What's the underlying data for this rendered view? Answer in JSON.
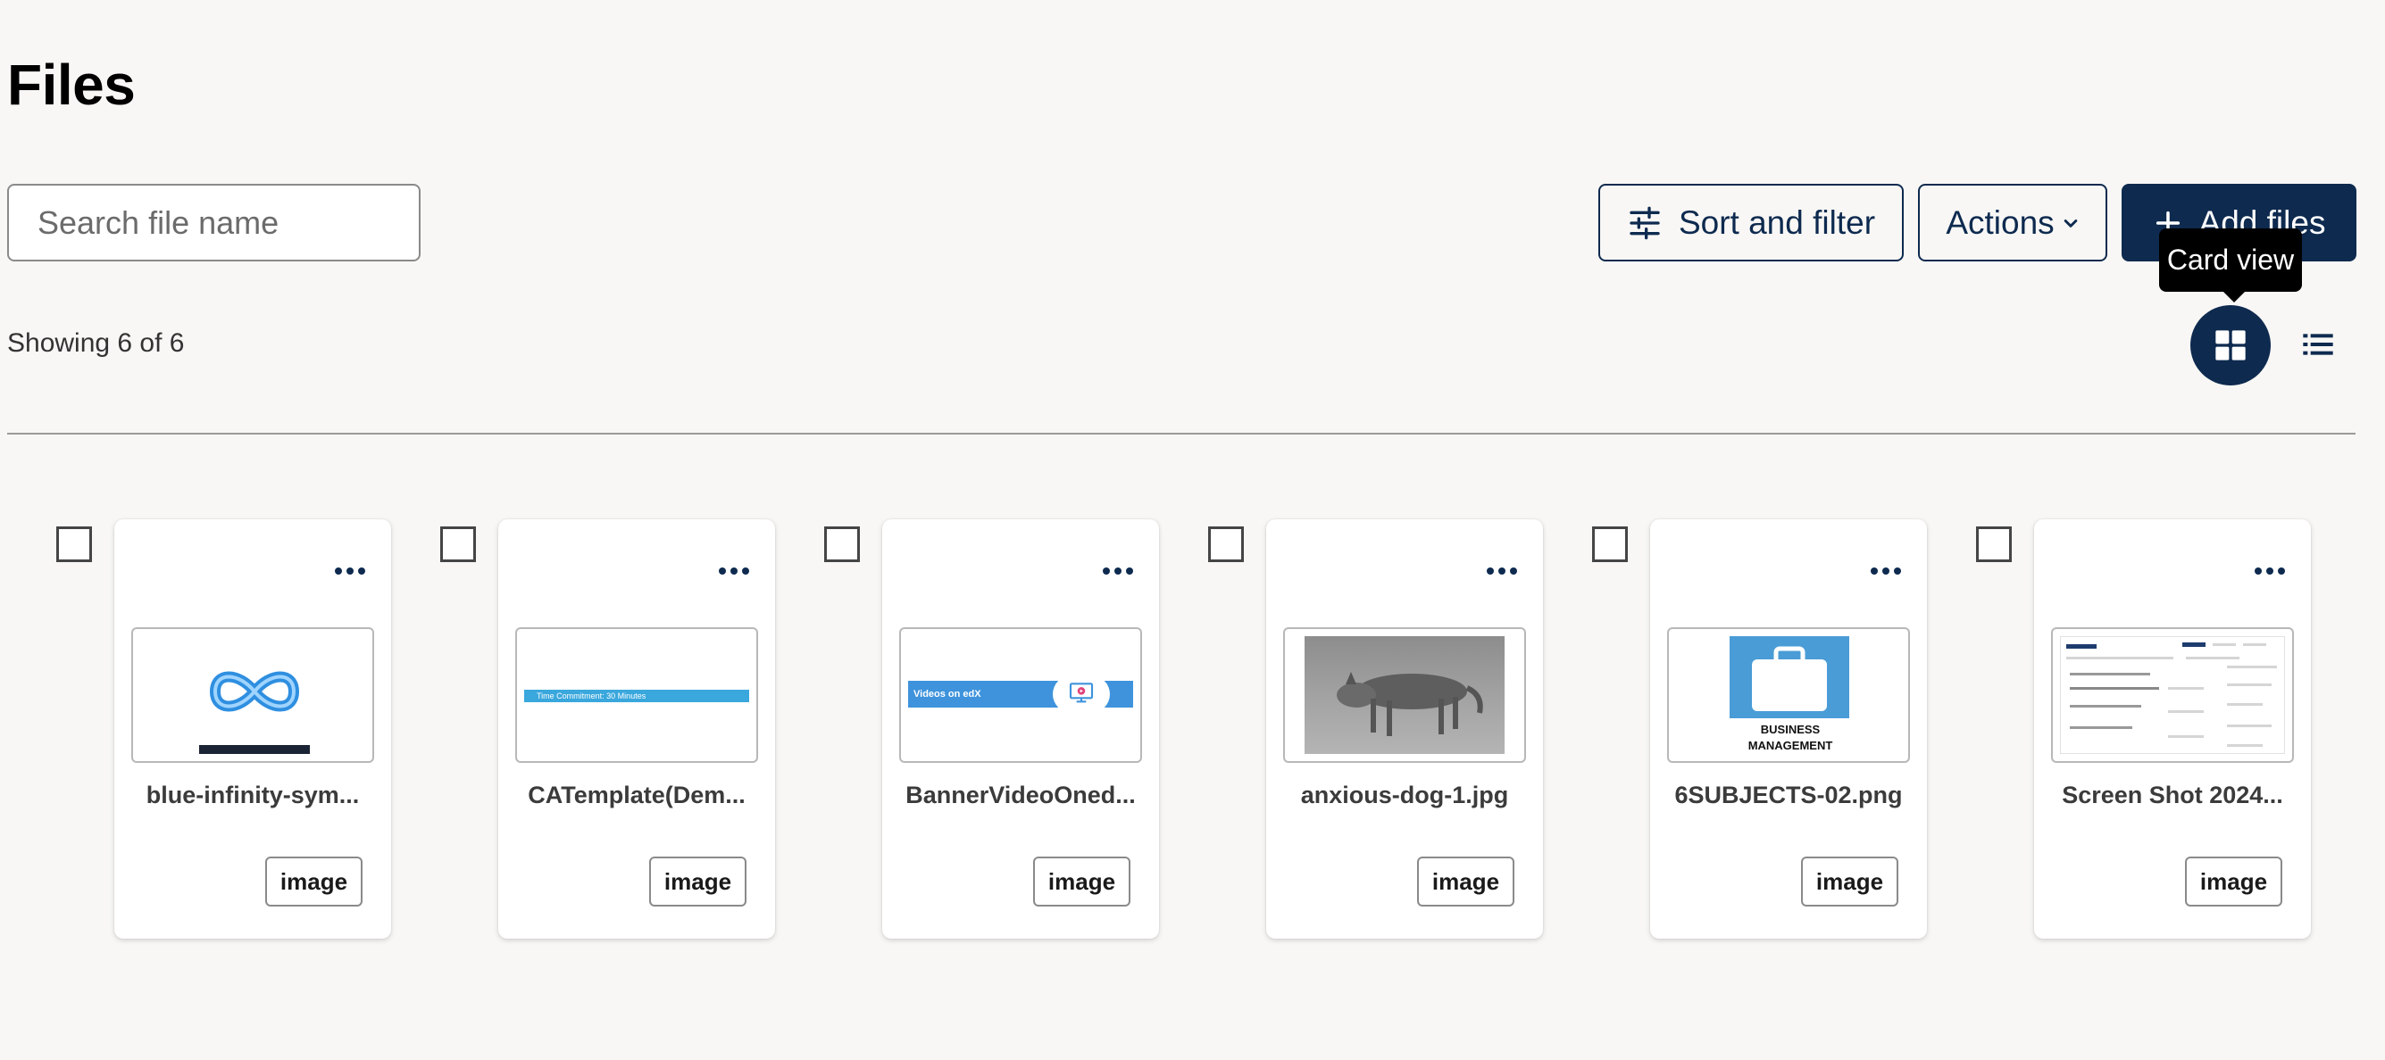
{
  "page": {
    "title": "Files",
    "showing_text": "Showing 6 of 6"
  },
  "search": {
    "placeholder": "Search file name",
    "value": ""
  },
  "toolbar": {
    "sort_label": "Sort and filter",
    "actions_label": "Actions",
    "add_label": "Add files"
  },
  "view_toggle": {
    "tooltip": "Card view",
    "selected": "card",
    "card_icon": "grid-icon",
    "list_icon": "list-icon"
  },
  "colors": {
    "primary": "#0e2a4f",
    "background": "#f8f7f5"
  },
  "files": [
    {
      "name": "blue-infinity-sym...",
      "type": "image",
      "thumb": "infinity-logo"
    },
    {
      "name": "CATemplate(Dem...",
      "type": "image",
      "thumb": "banner",
      "thumb_text": "Time Commitment: 30 Minutes"
    },
    {
      "name": "BannerVideoOned...",
      "type": "image",
      "thumb": "edx-banner",
      "thumb_text": "Videos on edX"
    },
    {
      "name": "anxious-dog-1.jpg",
      "type": "image",
      "thumb": "dog-photo"
    },
    {
      "name": "6SUBJECTS-02.png",
      "type": "image",
      "thumb": "business",
      "thumb_text_1": "BUSINESS",
      "thumb_text_2": "MANAGEMENT"
    },
    {
      "name": "Screen Shot 2024...",
      "type": "image",
      "thumb": "screenshot"
    }
  ]
}
